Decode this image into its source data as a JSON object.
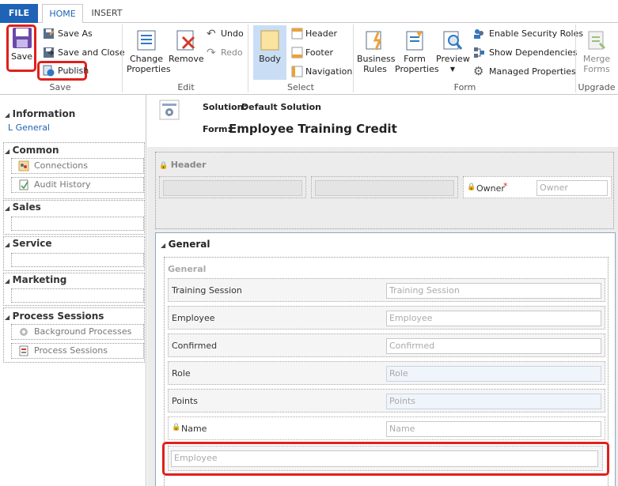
{
  "tabs": {
    "file": "FILE",
    "home": "HOME",
    "insert": "INSERT"
  },
  "ribbon": {
    "save": {
      "save": "Save",
      "save_as": "Save As",
      "save_and_close": "Save and Close",
      "publish": "Publish",
      "group": "Save"
    },
    "edit": {
      "change_properties_1": "Change",
      "change_properties_2": "Properties",
      "remove": "Remove",
      "undo": "Undo",
      "redo": "Redo",
      "group": "Edit"
    },
    "select": {
      "body": "Body",
      "header": "Header",
      "footer": "Footer",
      "navigation": "Navigation",
      "group": "Select"
    },
    "form": {
      "business_rules_1": "Business",
      "business_rules_2": "Rules",
      "form_properties_1": "Form",
      "form_properties_2": "Properties",
      "preview": "Preview",
      "enable_security_roles": "Enable Security Roles",
      "show_dependencies": "Show Dependencies",
      "managed_properties": "Managed Properties",
      "group": "Form"
    },
    "upgrade": {
      "merge_forms_1": "Merge",
      "merge_forms_2": "Forms",
      "group": "Upgrade"
    }
  },
  "leftnav": {
    "information": "Information",
    "general": "General",
    "common": "Common",
    "connections": "Connections",
    "audit_history": "Audit History",
    "sales": "Sales",
    "service": "Service",
    "marketing": "Marketing",
    "process_sessions": "Process Sessions",
    "background_processes": "Background Processes",
    "process_sessions_item": "Process Sessions"
  },
  "form": {
    "solution_label": "Solution:",
    "solution_name": "Default Solution",
    "form_label": "Form:",
    "form_name": "Employee Training Credit",
    "header_label": "Header",
    "owner_label": "Owner",
    "owner_required": "*",
    "owner_placeholder": "Owner",
    "general_tab": "General",
    "general_section": "General",
    "fields": [
      {
        "label": "Training Session",
        "placeholder": "Training Session"
      },
      {
        "label": "Employee",
        "placeholder": "Employee"
      },
      {
        "label": "Confirmed",
        "placeholder": "Confirmed"
      },
      {
        "label": "Role",
        "placeholder": "Role"
      },
      {
        "label": "Points",
        "placeholder": "Points"
      },
      {
        "label": "Name",
        "placeholder": "Name"
      }
    ],
    "new_field_placeholder": "Employee"
  }
}
